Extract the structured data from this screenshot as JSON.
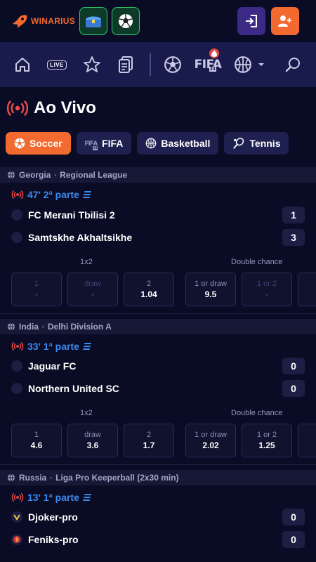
{
  "header": {
    "brand": "WINARIUS",
    "login_icon": "login-icon",
    "register_icon": "user-plus-icon"
  },
  "nav": {
    "live_label": "LIVE",
    "fifa_label": "FIFA",
    "fifa_year": "24"
  },
  "title": "Ao Vivo",
  "chips": [
    {
      "label": "Soccer",
      "icon": "soccer-ball-icon"
    },
    {
      "label": "FIFA",
      "icon": "fifa-icon",
      "icon_text": "FIFA",
      "icon_year": "24"
    },
    {
      "label": "Basketball",
      "icon": "basketball-icon"
    },
    {
      "label": "Tennis",
      "icon": "tennis-icon"
    }
  ],
  "markets": {
    "one_x_two": "1x2",
    "double_chance": "Double chance"
  },
  "matches": [
    {
      "country": "Georgia",
      "league": "Regional League",
      "time": "47' 2ª parte",
      "home": {
        "name": "FC Merani Tbilisi 2",
        "score": "1"
      },
      "away": {
        "name": "Samtskhe Akhaltsikhe",
        "score": "3"
      },
      "odds": [
        {
          "label": "1",
          "value": "-"
        },
        {
          "label": "draw",
          "value": "-"
        },
        {
          "label": "2",
          "value": "1.04"
        },
        {
          "label": "1 or draw",
          "value": "9.5"
        },
        {
          "label": "1 or 2",
          "value": "-"
        }
      ]
    },
    {
      "country": "India",
      "league": "Delhi Division A",
      "time": "33' 1ª parte",
      "home": {
        "name": "Jaguar FC",
        "score": "0"
      },
      "away": {
        "name": "Northern United SC",
        "score": "0"
      },
      "odds": [
        {
          "label": "1",
          "value": "4.6"
        },
        {
          "label": "draw",
          "value": "3.6"
        },
        {
          "label": "2",
          "value": "1.7"
        },
        {
          "label": "1 or draw",
          "value": "2.02"
        },
        {
          "label": "1 or 2",
          "value": "1.25"
        }
      ]
    },
    {
      "country": "Russia",
      "league": "Liga Pro Keeperball (2x30 min)",
      "time": "13' 1ª parte",
      "home": {
        "name": "Djoker-pro",
        "score": "0"
      },
      "away": {
        "name": "Feniks-pro",
        "score": "0"
      }
    }
  ],
  "colors": {
    "accent": "#f26a2f",
    "live_blue": "#3b8af0",
    "bg": "#0a0b24",
    "nav": "#1a1b4d"
  }
}
